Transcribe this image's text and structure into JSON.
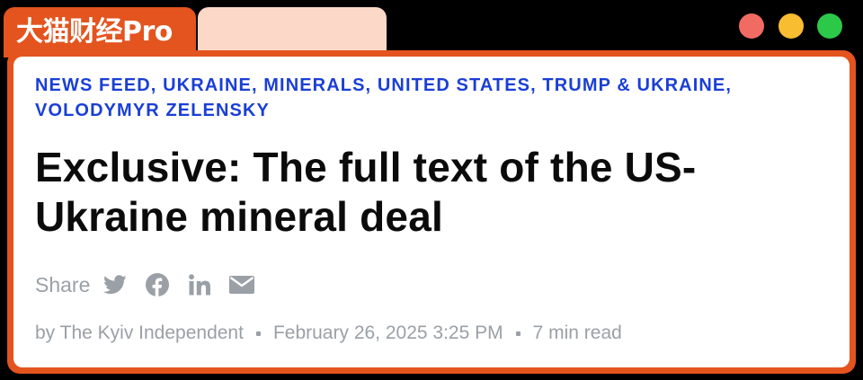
{
  "app": {
    "brand_label": "大猫财经Pro"
  },
  "window_controls": {
    "close_color": "#f26b63",
    "minimize_color": "#f8bd30",
    "maximize_color": "#2cc84a"
  },
  "colors": {
    "accent": "#e4541f",
    "tab_inactive": "#fcd8c8",
    "tag_blue": "#1a3fd6",
    "headline": "#0b0b0b",
    "muted": "#9aa0a6"
  },
  "article": {
    "tags": [
      "NEWS FEED",
      "UKRAINE",
      "MINERALS",
      "UNITED STATES",
      "TRUMP & UKRAINE",
      "VOLODYMYR ZELENSKY"
    ],
    "tag_separator": ", ",
    "headline": "Exclusive: The full text of the US-Ukraine mineral deal",
    "share": {
      "label": "Share",
      "icons": [
        "twitter-icon",
        "facebook-icon",
        "linkedin-icon",
        "mail-icon"
      ]
    },
    "byline": "by The Kyiv Independent",
    "date": "February 26, 2025 3:25 PM",
    "read_time": "7 min read"
  }
}
